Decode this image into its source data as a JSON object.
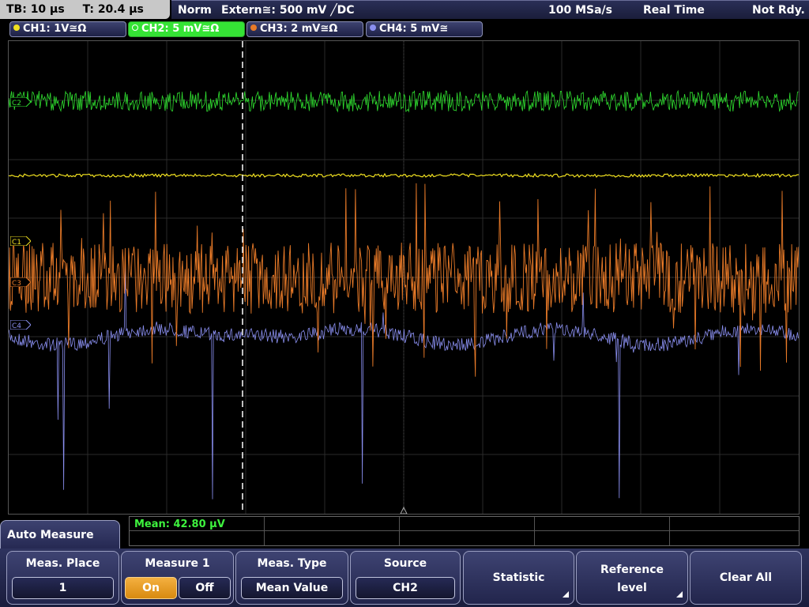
{
  "status": {
    "timebase": "TB: 10 µs",
    "trigger_time": "T: 20.4 µs",
    "mode": "Norm",
    "trigger": "Extern≅: 500 mV ╱DC",
    "sample_rate": "100 MSa/s",
    "acq_mode": "Real Time",
    "state": "Not Rdy."
  },
  "channels": [
    {
      "label": "CH1: 1V≅Ω",
      "color": "#f0e020",
      "marker": "C1"
    },
    {
      "label": "CH2: 5 mV≅Ω",
      "color": "#30e030",
      "marker": "C2"
    },
    {
      "label": "CH3: 2 mV≅Ω",
      "color": "#e87a28",
      "marker": "C3"
    },
    {
      "label": "CH4: 5 mV≅",
      "color": "#8a8ff0",
      "marker": "C4"
    }
  ],
  "trigger_marker": "T",
  "measurement": {
    "result": "Mean: 42.80 µV"
  },
  "menu": {
    "title": "Auto Measure",
    "meas_place": {
      "label": "Meas. Place",
      "value": "1"
    },
    "measure1": {
      "label": "Measure 1",
      "on": "On",
      "off": "Off",
      "state": "On"
    },
    "meas_type": {
      "label": "Meas. Type",
      "value": "Mean Value"
    },
    "source": {
      "label": "Source",
      "value": "CH2"
    },
    "statistic": {
      "label": "Statistic"
    },
    "reference_level": {
      "label1": "Reference",
      "label2": "level"
    },
    "clear_all": {
      "label": "Clear All"
    }
  }
}
